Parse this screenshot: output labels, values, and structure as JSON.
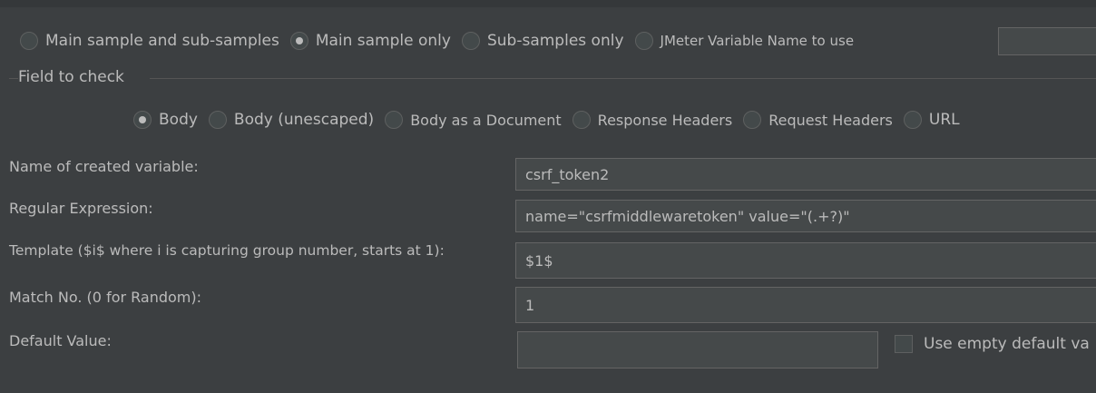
{
  "scope": {
    "options": [
      {
        "label": "Main sample and sub-samples",
        "selected": false
      },
      {
        "label": "Main sample only",
        "selected": true
      },
      {
        "label": "Sub-samples only",
        "selected": false
      },
      {
        "label": "JMeter Variable Name to use",
        "selected": false
      }
    ],
    "jmeter_variable_value": ""
  },
  "field_to_check": {
    "title": "Field to check",
    "options": [
      {
        "label": "Body",
        "selected": true
      },
      {
        "label": "Body (unescaped)",
        "selected": false
      },
      {
        "label": "Body as a Document",
        "selected": false
      },
      {
        "label": "Response Headers",
        "selected": false
      },
      {
        "label": "Request Headers",
        "selected": false
      },
      {
        "label": "URL",
        "selected": false
      }
    ]
  },
  "form": {
    "variable_name_label": "Name of created variable:",
    "variable_name_value": "csrf_token2",
    "regex_label": "Regular Expression:",
    "regex_value": "name=\"csrfmiddlewaretoken\" value=\"(.+?)\"",
    "template_label": "Template ($i$ where i is capturing group number, starts at 1):",
    "template_value": "$1$",
    "match_no_label": "Match No. (0 for Random):",
    "match_no_value": "1",
    "default_value_label": "Default Value:",
    "default_value_value": "",
    "use_empty_default_label": "Use empty default va",
    "use_empty_default_checked": false
  }
}
